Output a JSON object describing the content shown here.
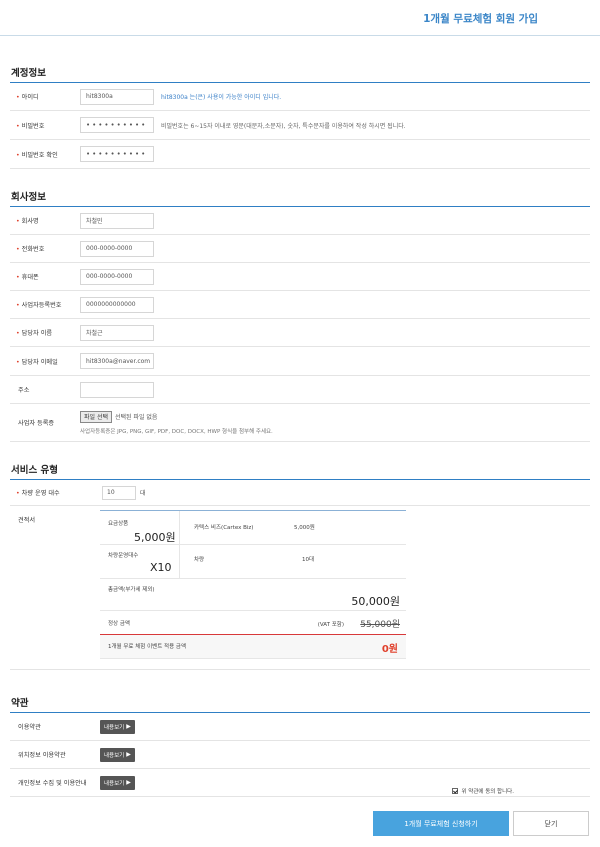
{
  "page": {
    "title": "1개월 무료체험 회원 가입"
  },
  "account": {
    "title": "계정정보",
    "id_label": "아이디",
    "id_value": "hit8300a",
    "id_hint": "hit8300a 는(은) 사용이 가능한 아이디 입니다.",
    "pw_label": "비밀번호",
    "pw_mask": "••••••••••",
    "pw_hint": "비밀번호는 6~15자 이내로 영문(대문자,소문자), 숫자, 특수문자를 이용하여 작성 하시면 됩니다.",
    "pw_confirm_label": "비밀번호 확인",
    "pw_confirm_mask": "••••••••••"
  },
  "company": {
    "title": "회사정보",
    "name_label": "회사명",
    "name_value": "차철민",
    "phone_label": "전화번호",
    "phone_placeholder": "000-0000-0000",
    "mobile_label": "휴대폰",
    "mobile_placeholder": "000-0000-0000",
    "bizno_label": "사업자등록번호",
    "bizno_placeholder": "0000000000000",
    "manager_label": "담당자 이름",
    "manager_value": "차철근",
    "email_label": "담당자 이메일",
    "email_value": "hit8300a@naver.com",
    "address_label": "주소",
    "address_value": "",
    "cert_label": "사업자 등록증",
    "file_button": "파일 선택",
    "file_none": "선택된 파일 없음",
    "file_note": "사업자등록증은 JPG, PNG, GIF, PDF, DOC, DOCX, HWP 형식을 첨부해 주세요."
  },
  "service": {
    "title": "서비스 유형",
    "vehicle_label": "차량 운영 대수",
    "vehicle_value": "10",
    "vehicle_unit": "대",
    "estimate_label": "견적서",
    "estimate": {
      "plan_label": "요금상품",
      "plan_price": "5,000원",
      "plan_name": "카텍스 비즈(Cartex Biz)",
      "plan_unit_price": "5,000원",
      "vehicles_label": "차량운영대수",
      "vehicles_value": "X10",
      "vehicle_text": "차량",
      "vehicle_count": "10대",
      "total_label": "총금액(부가세 제외)",
      "total_value": "50,000원",
      "regular_label": "정상 금액",
      "vat_note": "(VAT 포함)",
      "regular_value": "55,000원",
      "event_label": "1개월 무료 체험 이벤트 적용 금액",
      "event_value": "0원"
    }
  },
  "terms": {
    "title": "약관",
    "items": [
      {
        "label": "이용약관",
        "button": "내용보기"
      },
      {
        "label": "위치정보 이용약관",
        "button": "내용보기"
      },
      {
        "label": "개인정보 수집 및 이용안내",
        "button": "내용보기"
      }
    ],
    "agree_text": "위 약관에 동의 합니다."
  },
  "actions": {
    "submit": "1개월 무료체험 신청하기",
    "close": "닫기"
  },
  "colors": {
    "accent": "#48a3de",
    "required": "#e0402c",
    "price_red": "#e0402c"
  }
}
